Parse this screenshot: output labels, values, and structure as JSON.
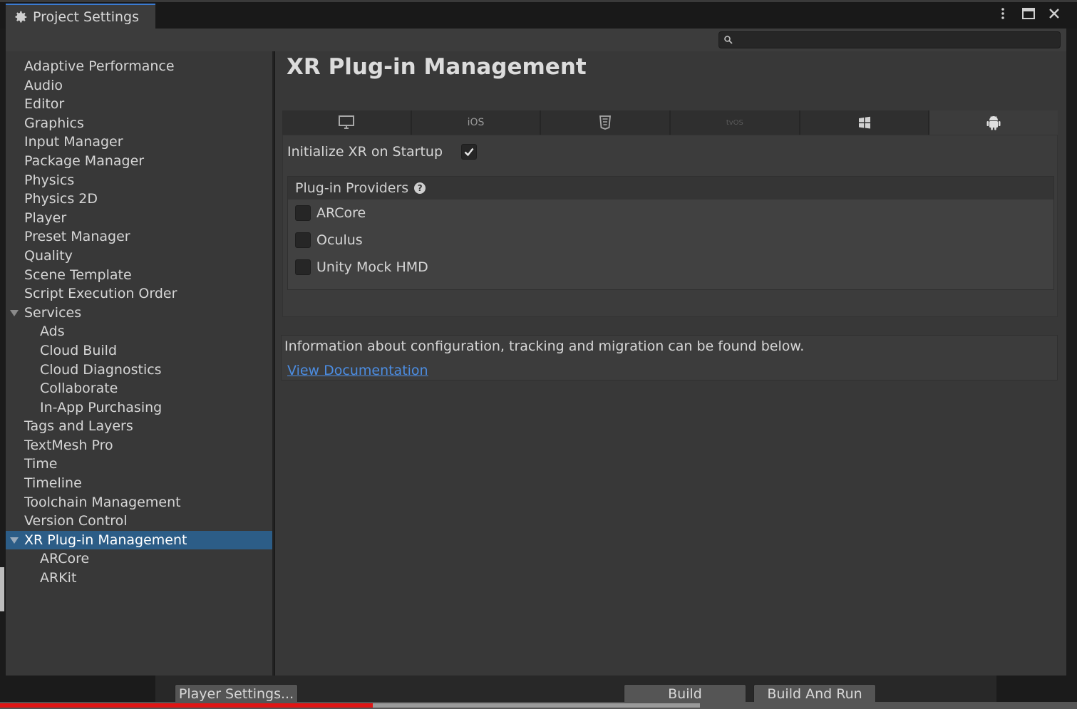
{
  "window": {
    "tab_title": "Project Settings",
    "tab_icon": "gear-icon",
    "controls": [
      "more-options-icon",
      "maximize-icon",
      "close-icon"
    ]
  },
  "search": {
    "placeholder": "",
    "icon": "search-icon"
  },
  "sidebar": {
    "items": [
      {
        "label": "Adaptive Performance",
        "level": 0
      },
      {
        "label": "Audio",
        "level": 0
      },
      {
        "label": "Editor",
        "level": 0
      },
      {
        "label": "Graphics",
        "level": 0
      },
      {
        "label": "Input Manager",
        "level": 0
      },
      {
        "label": "Package Manager",
        "level": 0
      },
      {
        "label": "Physics",
        "level": 0
      },
      {
        "label": "Physics 2D",
        "level": 0
      },
      {
        "label": "Player",
        "level": 0
      },
      {
        "label": "Preset Manager",
        "level": 0
      },
      {
        "label": "Quality",
        "level": 0
      },
      {
        "label": "Scene Template",
        "level": 0
      },
      {
        "label": "Script Execution Order",
        "level": 0
      },
      {
        "label": "Services",
        "level": 0,
        "expanded": true
      },
      {
        "label": "Ads",
        "level": 1
      },
      {
        "label": "Cloud Build",
        "level": 1
      },
      {
        "label": "Cloud Diagnostics",
        "level": 1
      },
      {
        "label": "Collaborate",
        "level": 1
      },
      {
        "label": "In-App Purchasing",
        "level": 1
      },
      {
        "label": "Tags and Layers",
        "level": 0
      },
      {
        "label": "TextMesh Pro",
        "level": 0
      },
      {
        "label": "Time",
        "level": 0
      },
      {
        "label": "Timeline",
        "level": 0
      },
      {
        "label": "Toolchain Management",
        "level": 0
      },
      {
        "label": "Version Control",
        "level": 0
      },
      {
        "label": "XR Plug-in Management",
        "level": 0,
        "expanded": true,
        "selected": true
      },
      {
        "label": "ARCore",
        "level": 1
      },
      {
        "label": "ARKit",
        "level": 1
      }
    ]
  },
  "main": {
    "title": "XR Plug-in Management",
    "platform_tabs": [
      {
        "name": "standalone",
        "icon": "monitor-icon",
        "label": ""
      },
      {
        "name": "ios",
        "icon": "",
        "label": "iOS"
      },
      {
        "name": "webgl",
        "icon": "html5-icon",
        "label": ""
      },
      {
        "name": "tvos",
        "icon": "",
        "label": "tvOS"
      },
      {
        "name": "windows",
        "icon": "windows-icon",
        "label": ""
      },
      {
        "name": "android",
        "icon": "android-icon",
        "label": "",
        "active": true
      }
    ],
    "initialize_label": "Initialize XR on Startup",
    "initialize_checked": true,
    "providers_header": "Plug-in Providers",
    "providers": [
      {
        "label": "ARCore",
        "checked": false
      },
      {
        "label": "Oculus",
        "checked": false
      },
      {
        "label": "Unity Mock HMD",
        "checked": false
      }
    ],
    "info_text": "Information about configuration, tracking and migration can be found below.",
    "doc_link": "View Documentation"
  },
  "footer": {
    "player_settings": "Player Settings...",
    "build": "Build",
    "build_and_run": "Build And Run"
  },
  "video_progress": {
    "played": 0.346,
    "buffered": 0.65
  },
  "colors": {
    "accent": "#2c5d87",
    "link": "#4c8de2",
    "progress": "#e01515"
  }
}
